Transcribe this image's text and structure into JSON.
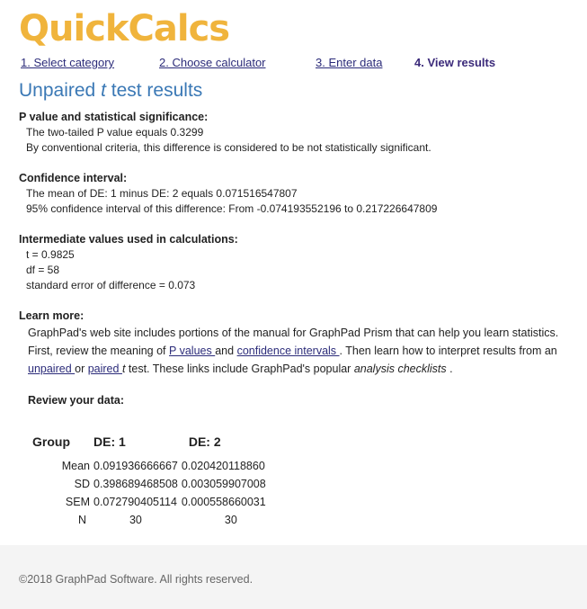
{
  "header": {
    "logo_text": "QuickCalcs",
    "brand_color": "#f0b43c"
  },
  "steps": [
    {
      "label": "1. Select category"
    },
    {
      "label": "2. Choose calculator"
    },
    {
      "label": "3. Enter data"
    },
    {
      "label": "4. View results"
    }
  ],
  "page": {
    "title_prefix": "Unpaired ",
    "title_t": "t",
    "title_suffix": " test results"
  },
  "pvalue": {
    "heading": "P value and statistical significance:",
    "line1": "The two-tailed P value equals 0.3299",
    "line2": "By conventional criteria, this difference is considered to be not statistically significant."
  },
  "ci": {
    "heading": "Confidence interval:",
    "line1": "The mean of DE: 1 minus DE: 2 equals 0.071516547807",
    "line2": "95% confidence interval of this difference: From -0.074193552196 to 0.217226647809"
  },
  "intermediate": {
    "heading": "Intermediate values used in calculations:",
    "t": "t = 0.9825",
    "df": "df = 58",
    "se": "standard error of difference = 0.073"
  },
  "learn": {
    "heading": "Learn more:",
    "text1": "GraphPad's web site includes portions of the manual for GraphPad Prism that can help you learn statistics. First, review the meaning of ",
    "link_pvalues": "P values ",
    "text2": "and ",
    "link_ci": "confidence intervals ",
    "text3": ". Then learn how to interpret results from an ",
    "link_unpaired": "unpaired ",
    "text4": "or ",
    "link_paired": "paired ",
    "text_t": "t",
    "text5": " test. These links include GraphPad's popular ",
    "text_checklists": "analysis checklists",
    "text6": " ."
  },
  "review": {
    "heading": "Review your data:",
    "columns": [
      "Group",
      "DE: 1",
      "DE: 2"
    ],
    "rows": [
      {
        "label": "Mean",
        "c1": "0.091936666667",
        "c2": "0.020420118860"
      },
      {
        "label": "SD",
        "c1": "0.398689468508",
        "c2": "0.003059907008"
      },
      {
        "label": "SEM",
        "c1": "0.072790405114",
        "c2": "0.000558660031"
      },
      {
        "label": "N",
        "c1": "30",
        "c2": "30"
      }
    ]
  },
  "footer": {
    "copyright": "©2018 GraphPad Software. All rights reserved."
  }
}
